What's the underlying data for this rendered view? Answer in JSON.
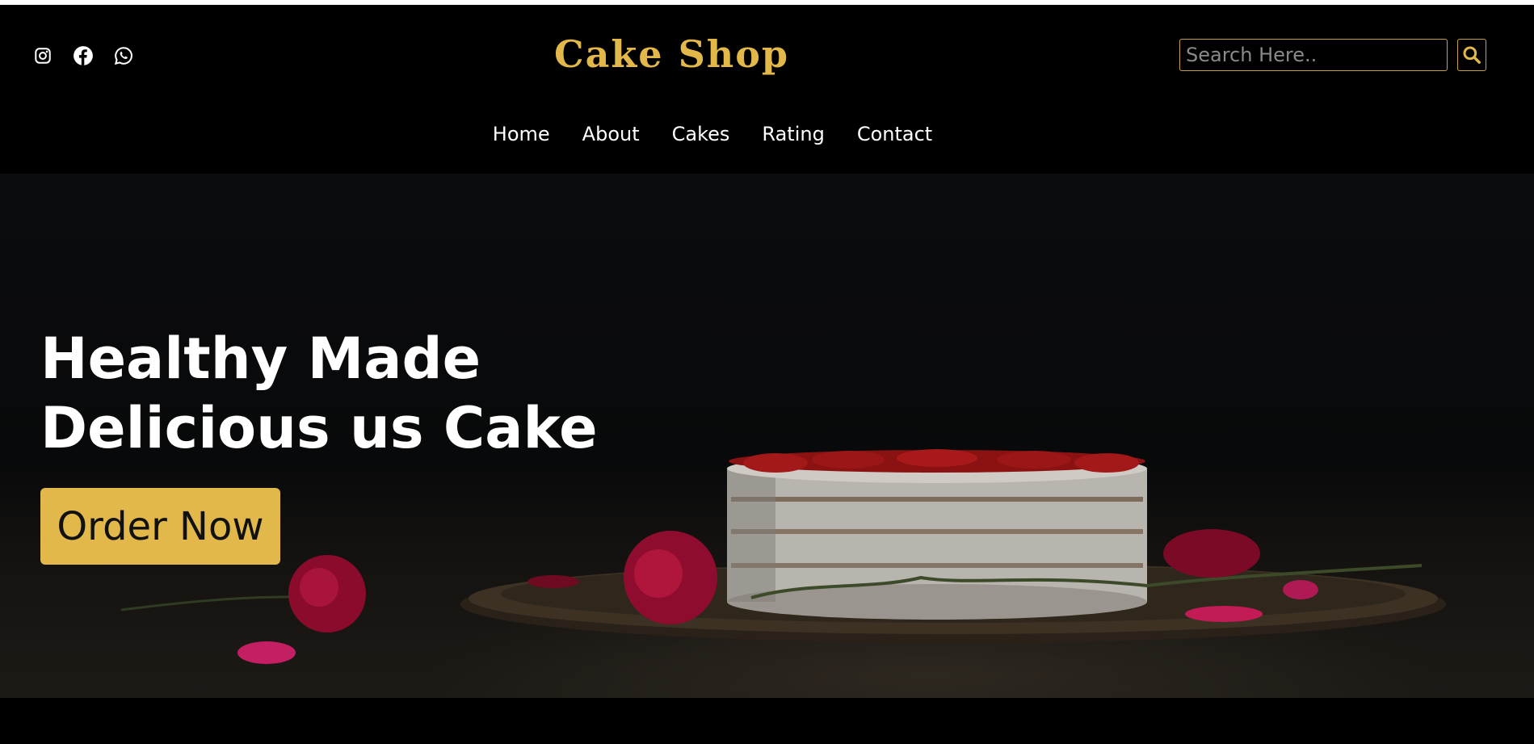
{
  "header": {
    "brand": "Cake Shop",
    "social_icons": [
      "instagram-icon",
      "facebook-icon",
      "whatsapp-icon"
    ],
    "search": {
      "placeholder": "Search Here..",
      "value": ""
    },
    "nav": [
      "Home",
      "About",
      "Cakes",
      "Rating",
      "Contact"
    ]
  },
  "hero": {
    "title_line1": "Healthy Made",
    "title_line2": "Delicious us Cake",
    "cta_label": "Order Now"
  },
  "colors": {
    "accent": "#e3b84a",
    "background": "#000000",
    "text": "#ffffff"
  }
}
